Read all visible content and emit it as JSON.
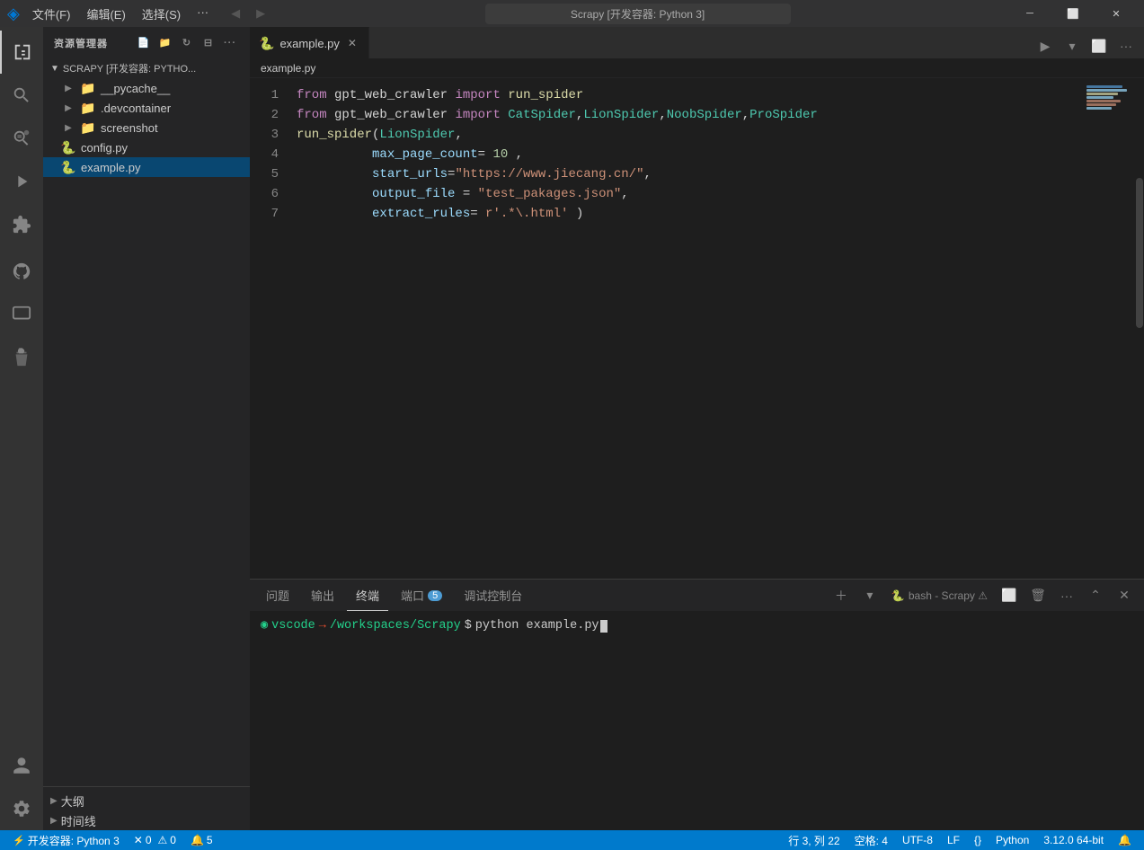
{
  "titlebar": {
    "vscode_icon": "◈",
    "menu": [
      "文件(F)",
      "编辑(E)",
      "选择(S)",
      "···"
    ],
    "search_placeholder": "Scrapy [开发容器: Python 3]",
    "window_title": "Scrapy [开发容器: Python 3]",
    "nav_back": "◀",
    "nav_forward": "▶",
    "win_minimize": "─",
    "win_restore": "⬜",
    "win_close": "✕"
  },
  "activity_bar": {
    "items": [
      {
        "icon": "📋",
        "name": "explorer",
        "label": "资源管理器"
      },
      {
        "icon": "🔍",
        "name": "search",
        "label": "搜索"
      },
      {
        "icon": "⑂",
        "name": "source-control",
        "label": "源代码管理"
      },
      {
        "icon": "▶",
        "name": "run",
        "label": "运行和调试"
      },
      {
        "icon": "⊞",
        "name": "extensions",
        "label": "扩展"
      },
      {
        "icon": "🔀",
        "name": "github",
        "label": "GitHub"
      },
      {
        "icon": "🖥",
        "name": "remote-explorer",
        "label": "远程资源管理器"
      },
      {
        "icon": "🔬",
        "name": "testing",
        "label": "测试"
      }
    ],
    "bottom_items": [
      {
        "icon": "👤",
        "name": "account",
        "label": "账户"
      },
      {
        "icon": "⚙",
        "name": "settings",
        "label": "设置"
      }
    ]
  },
  "sidebar": {
    "header": "资源管理器",
    "section_title": "SCRAPY [开发容器: PYTHO...",
    "tree": [
      {
        "indent": 1,
        "type": "folder",
        "name": "__pycache__",
        "label": "__pycache__"
      },
      {
        "indent": 1,
        "type": "folder",
        "name": ".devcontainer",
        "label": ".devcontainer"
      },
      {
        "indent": 1,
        "type": "folder",
        "name": "screenshot",
        "label": "screenshot"
      },
      {
        "indent": 1,
        "type": "py",
        "name": "config.py",
        "label": "config.py"
      },
      {
        "indent": 1,
        "type": "py",
        "name": "example.py",
        "label": "example.py"
      }
    ],
    "bottom_sections": [
      {
        "label": "大纲",
        "name": "outline"
      },
      {
        "label": "时间线",
        "name": "timeline"
      }
    ]
  },
  "editor": {
    "tab": {
      "icon": "🐍",
      "filename": "example.py",
      "active": true
    },
    "breadcrumb": {
      "file": "example.py"
    },
    "lines": [
      {
        "num": 1,
        "content": "from gpt_web_crawler import run_spider"
      },
      {
        "num": 2,
        "content": "from gpt_web_crawler import CatSpider,LionSpider,NoobSpider,ProSpider"
      },
      {
        "num": 3,
        "content": "run_spider(LionSpider,"
      },
      {
        "num": 4,
        "content": "          max_page_count= 10 ,"
      },
      {
        "num": 5,
        "content": "          start_urls=\"https://www.jiecang.cn/\","
      },
      {
        "num": 6,
        "content": "          output_file = \"test_pakages.json\","
      },
      {
        "num": 7,
        "content": "          extract_rules= r'.*\\.html' )"
      }
    ]
  },
  "terminal": {
    "tabs": [
      {
        "label": "问题",
        "name": "problems"
      },
      {
        "label": "输出",
        "name": "output"
      },
      {
        "label": "终端",
        "name": "terminal",
        "active": true
      },
      {
        "label": "端口",
        "name": "ports"
      },
      {
        "label": "5",
        "name": "ports-badge"
      },
      {
        "label": "调试控制台",
        "name": "debug-console"
      }
    ],
    "terminal_instance": "bash - Scrapy ⚠",
    "prompt": {
      "dot": "◉",
      "path": "vscode",
      "arrow": "→",
      "dir": "/workspaces/Scrapy",
      "dollar": "$",
      "cmd": "python example.py"
    },
    "actions": {
      "add": "+",
      "split": "⬜",
      "trash": "🗑",
      "more": "···",
      "collapse": "⌃",
      "close": "✕"
    }
  },
  "statusbar": {
    "remote": "开发容器: Python 3",
    "errors": "0",
    "warnings": "0",
    "notifications": "5",
    "position": "行 3, 列 22",
    "spaces": "空格: 4",
    "encoding": "UTF-8",
    "line_ending": "LF",
    "format": "{}",
    "language": "Python",
    "python_version": "3.12.0 64-bit",
    "bell": "🔔"
  },
  "minimap": {
    "lines": [
      {
        "width": "80%",
        "color": "#569cd6"
      },
      {
        "width": "90%",
        "color": "#9cdcfe"
      },
      {
        "width": "70%",
        "color": "#dcdcaa"
      },
      {
        "width": "60%",
        "color": "#9cdcfe"
      },
      {
        "width": "75%",
        "color": "#ce9178"
      },
      {
        "width": "65%",
        "color": "#ce9178"
      },
      {
        "width": "55%",
        "color": "#9cdcfe"
      }
    ]
  }
}
